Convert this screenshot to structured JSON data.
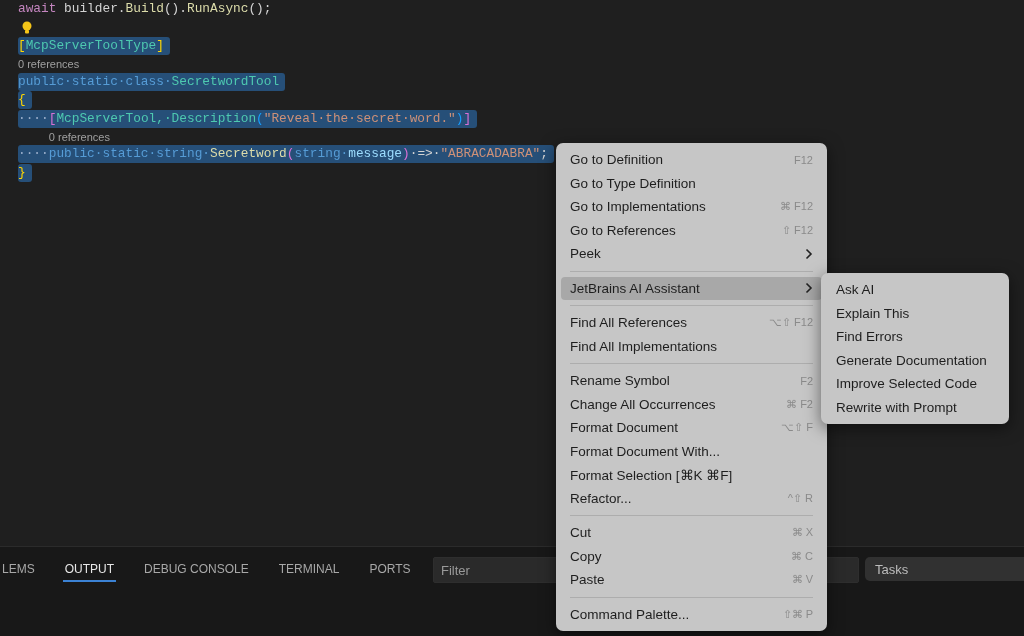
{
  "editor": {
    "lines": [
      {
        "kind": "code",
        "selected": false,
        "tokens": [
          {
            "t": "await",
            "kind": "control"
          },
          {
            "t": " builder.",
            "kind": "plain"
          },
          {
            "t": "Build",
            "kind": "method"
          },
          {
            "t": "().",
            "kind": "plain"
          },
          {
            "t": "RunAsync",
            "kind": "method"
          },
          {
            "t": "();",
            "kind": "plain"
          }
        ]
      },
      {
        "kind": "bulb"
      },
      {
        "kind": "code",
        "selected": true,
        "tokens": [
          {
            "t": "[",
            "kind": "bracket"
          },
          {
            "t": "McpServerToolType",
            "kind": "type"
          },
          {
            "t": "]",
            "kind": "bracket"
          }
        ]
      },
      {
        "kind": "code",
        "selected": true,
        "codelens": "0 references",
        "tokens": [
          {
            "t": "public·static·class·",
            "kind": "keyword"
          },
          {
            "t": "SecretwordTool",
            "kind": "type"
          }
        ]
      },
      {
        "kind": "code",
        "selected": true,
        "tokens": [
          {
            "t": "{",
            "kind": "bracket"
          }
        ]
      },
      {
        "kind": "code",
        "selected": true,
        "tokens": [
          {
            "t": "····",
            "kind": "space"
          },
          {
            "t": "[",
            "kind": "bracket2"
          },
          {
            "t": "McpServerTool,·Description",
            "kind": "type"
          },
          {
            "t": "(",
            "kind": "bracket3"
          },
          {
            "t": "\"Reveal·the·secret·word.\"",
            "kind": "string"
          },
          {
            "t": ")",
            "kind": "bracket3"
          },
          {
            "t": "]",
            "kind": "bracket2"
          }
        ]
      },
      {
        "kind": "code",
        "selected": true,
        "codelens": "0 references",
        "tokens": [
          {
            "t": "····",
            "kind": "space"
          },
          {
            "t": "public·static·string·",
            "kind": "keyword"
          },
          {
            "t": "Secretword",
            "kind": "method"
          },
          {
            "t": "(",
            "kind": "bracket2"
          },
          {
            "t": "string·",
            "kind": "keyword"
          },
          {
            "t": "message",
            "kind": "param"
          },
          {
            "t": ")",
            "kind": "bracket2"
          },
          {
            "t": "·=>·",
            "kind": "plain"
          },
          {
            "t": "\"ABRACADABRA\"",
            "kind": "string"
          },
          {
            "t": ";",
            "kind": "plain"
          }
        ]
      },
      {
        "kind": "code",
        "selected": true,
        "tokens": [
          {
            "t": "}",
            "kind": "bracket"
          }
        ]
      }
    ]
  },
  "panel": {
    "tabs": [
      {
        "label": "LEMS",
        "selected": false
      },
      {
        "label": "OUTPUT",
        "selected": true
      },
      {
        "label": "DEBUG CONSOLE",
        "selected": false
      },
      {
        "label": "TERMINAL",
        "selected": false
      },
      {
        "label": "PORTS",
        "selected": false
      }
    ],
    "filter": {
      "placeholder": "Filter"
    },
    "task_select": {
      "value": "Tasks"
    }
  },
  "context_menu": {
    "items": [
      {
        "kind": "item",
        "label": "Go to Definition",
        "shortcut": "F12",
        "selected": false
      },
      {
        "kind": "item",
        "label": "Go to Type Definition",
        "selected": false
      },
      {
        "kind": "item",
        "label": "Go to Implementations",
        "shortcut": "⌘ F12",
        "selected": false
      },
      {
        "kind": "item",
        "label": "Go to References",
        "shortcut": "⇧ F12",
        "selected": false
      },
      {
        "kind": "submenu",
        "label": "Peek",
        "selected": false
      },
      {
        "kind": "separator"
      },
      {
        "kind": "submenu",
        "label": "JetBrains AI Assistant",
        "selected": true
      },
      {
        "kind": "separator"
      },
      {
        "kind": "item",
        "label": "Find All References",
        "shortcut": "⌥⇧ F12",
        "selected": false
      },
      {
        "kind": "item",
        "label": "Find All Implementations",
        "selected": false
      },
      {
        "kind": "separator"
      },
      {
        "kind": "item",
        "label": "Rename Symbol",
        "shortcut": "F2",
        "selected": false
      },
      {
        "kind": "item",
        "label": "Change All Occurrences",
        "shortcut": "⌘ F2",
        "selected": false
      },
      {
        "kind": "item",
        "label": "Format Document",
        "shortcut": "⌥⇧ F",
        "selected": false
      },
      {
        "kind": "item",
        "label": "Format Document With...",
        "selected": false
      },
      {
        "kind": "item",
        "label": "Format Selection [⌘K ⌘F]",
        "selected": false
      },
      {
        "kind": "item",
        "label": "Refactor...",
        "shortcut": "^⇧ R",
        "selected": false
      },
      {
        "kind": "separator"
      },
      {
        "kind": "item",
        "label": "Cut",
        "shortcut": "⌘ X",
        "selected": false
      },
      {
        "kind": "item",
        "label": "Copy",
        "shortcut": "⌘ C",
        "selected": false
      },
      {
        "kind": "item",
        "label": "Paste",
        "shortcut": "⌘ V",
        "selected": false
      },
      {
        "kind": "separator"
      },
      {
        "kind": "item",
        "label": "Command Palette...",
        "shortcut": "⇧⌘ P",
        "selected": false
      }
    ]
  },
  "submenu": {
    "items": [
      {
        "label": "Ask AI"
      },
      {
        "label": "Explain This"
      },
      {
        "label": "Find Errors"
      },
      {
        "label": "Generate Documentation"
      },
      {
        "label": "Improve Selected Code"
      },
      {
        "label": "Rewrite with Prompt"
      }
    ]
  }
}
